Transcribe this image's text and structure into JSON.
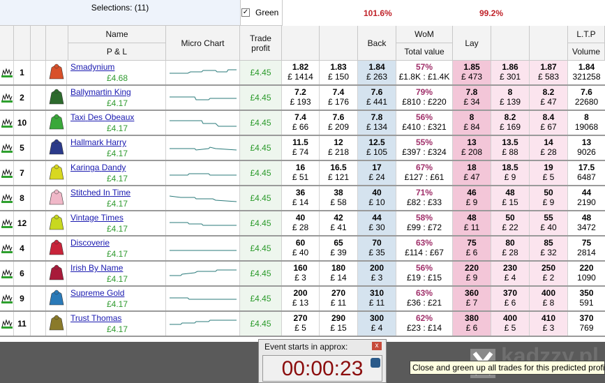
{
  "header": {
    "selections": "Selections: (11)",
    "green_label": "Green",
    "green_checked": "✓",
    "back_pct": "101.6%",
    "lay_pct": "99.2%",
    "name": "Name",
    "pl": "P & L",
    "micro_chart": "Micro Chart",
    "trade_profit": "Trade profit",
    "back": "Back",
    "wom": "WoM",
    "total_value": "Total value",
    "lay": "Lay",
    "ltp": "L.T.P",
    "volume": "Volume"
  },
  "colors": {
    "back_best": "#d5e3ef",
    "lay_best": "#f3c6d8",
    "lay_other": "#fbe4ee",
    "green": "#2e9a2e",
    "red": "#c0232a"
  },
  "runners": [
    {
      "num": "1",
      "name_a": "Smadynium",
      "name_b": "",
      "pl": "£4.68",
      "trade": "£4.45",
      "b1": "1.82",
      "b1s": "£ 1414",
      "b2": "1.83",
      "b2s": "£ 150",
      "b3": "1.84",
      "b3s": "£ 263",
      "wom": "57%",
      "womv": "£1.8K : £1.4K",
      "l1": "1.85",
      "l1s": "£ 473",
      "l2": "1.86",
      "l2s": "£ 301",
      "l3": "1.87",
      "l3s": "£ 583",
      "ltp": "1.84",
      "vol": "321258",
      "silk": "#d8502a"
    },
    {
      "num": "2",
      "name_a": "Ballymartin",
      "name_b": "King",
      "pl": "£4.17",
      "trade": "£4.45",
      "b1": "7.2",
      "b1s": "£ 193",
      "b2": "7.4",
      "b2s": "£ 176",
      "b3": "7.6",
      "b3s": "£ 441",
      "wom": "79%",
      "womv": "£810 : £220",
      "l1": "7.8",
      "l1s": "£ 34",
      "l2": "8",
      "l2s": "£ 139",
      "l3": "8.2",
      "l3s": "£ 47",
      "ltp": "7.6",
      "vol": "22680",
      "silk": "#2d6a2d"
    },
    {
      "num": "10",
      "name_a": "Taxi",
      "name_b": "Des",
      "name_c": "Obeaux",
      "pl": "£4.17",
      "trade": "£4.45",
      "b1": "7.4",
      "b1s": "£ 66",
      "b2": "7.6",
      "b2s": "£ 209",
      "b3": "7.8",
      "b3s": "£ 134",
      "wom": "56%",
      "womv": "£410 : £321",
      "l1": "8",
      "l1s": "£ 84",
      "l2": "8.2",
      "l2s": "£ 169",
      "l3": "8.4",
      "l3s": "£ 67",
      "ltp": "8",
      "vol": "19068",
      "silk": "#3aa83a"
    },
    {
      "num": "5",
      "name_a": "Hallmark",
      "name_b": "Harry",
      "pl": "£4.17",
      "trade": "£4.45",
      "b1": "11.5",
      "b1s": "£ 74",
      "b2": "12",
      "b2s": "£ 218",
      "b3": "12.5",
      "b3s": "£ 105",
      "wom": "55%",
      "womv": "£397 : £324",
      "l1": "13",
      "l1s": "£ 208",
      "l2": "13.5",
      "l2s": "£ 88",
      "l3": "14",
      "l3s": "£ 28",
      "ltp": "13",
      "vol": "9026",
      "silk": "#2b3a8a"
    },
    {
      "num": "7",
      "name_a": "Karinga",
      "name_b": "Dandy",
      "pl": "£4.17",
      "trade": "£4.45",
      "b1": "16",
      "b1s": "£ 51",
      "b2": "16.5",
      "b2s": "£ 121",
      "b3": "17",
      "b3s": "£ 24",
      "wom": "67%",
      "womv": "£127 : £61",
      "l1": "18",
      "l1s": "£ 47",
      "l2": "18.5",
      "l2s": "£ 9",
      "l3": "19",
      "l3s": "£ 5",
      "ltp": "17.5",
      "vol": "6487",
      "silk": "#d8d820"
    },
    {
      "num": "8",
      "name_a": "Stitched",
      "name_b": "In",
      "name_c": "Time",
      "pl": "£4.17",
      "trade": "£4.45",
      "b1": "36",
      "b1s": "£ 14",
      "b2": "38",
      "b2s": "£ 58",
      "b3": "40",
      "b3s": "£ 10",
      "wom": "71%",
      "womv": "£82 : £33",
      "l1": "46",
      "l1s": "£ 9",
      "l2": "48",
      "l2s": "£ 15",
      "l3": "50",
      "l3s": "£ 9",
      "ltp": "44",
      "vol": "2190",
      "silk": "#f0b8c8"
    },
    {
      "num": "12",
      "name_a": "Vintage",
      "name_b": "Times",
      "pl": "£4.17",
      "trade": "£4.45",
      "b1": "40",
      "b1s": "£ 28",
      "b2": "42",
      "b2s": "£ 41",
      "b3": "44",
      "b3s": "£ 30",
      "wom": "58%",
      "womv": "£99 : £72",
      "l1": "48",
      "l1s": "£ 11",
      "l2": "50",
      "l2s": "£ 22",
      "l3": "55",
      "l3s": "£ 40",
      "ltp": "48",
      "vol": "3472",
      "silk": "#c8d820"
    },
    {
      "num": "4",
      "name_a": "Discoverie",
      "name_b": "",
      "pl": "£4.17",
      "trade": "£4.45",
      "b1": "60",
      "b1s": "£ 40",
      "b2": "65",
      "b2s": "£ 39",
      "b3": "70",
      "b3s": "£ 35",
      "wom": "63%",
      "womv": "£114 : £67",
      "l1": "75",
      "l1s": "£ 6",
      "l2": "80",
      "l2s": "£ 28",
      "l3": "85",
      "l3s": "£ 32",
      "ltp": "75",
      "vol": "2814",
      "silk": "#c8243a"
    },
    {
      "num": "6",
      "name_a": "Irish",
      "name_b": "By",
      "name_c": "Name",
      "pl": "£4.17",
      "trade": "£4.45",
      "b1": "160",
      "b1s": "£ 3",
      "b2": "180",
      "b2s": "£ 14",
      "b3": "200",
      "b3s": "£ 3",
      "wom": "56%",
      "womv": "£19 : £15",
      "l1": "220",
      "l1s": "£ 9",
      "l2": "230",
      "l2s": "£ 4",
      "l3": "250",
      "l3s": "£ 2",
      "ltp": "220",
      "vol": "1090",
      "silk": "#a81a3a"
    },
    {
      "num": "9",
      "name_a": "Supreme",
      "name_b": "Gold",
      "pl": "£4.17",
      "trade": "£4.45",
      "b1": "200",
      "b1s": "£ 13",
      "b2": "270",
      "b2s": "£ 11",
      "b3": "310",
      "b3s": "£ 11",
      "wom": "63%",
      "womv": "£36 : £21",
      "l1": "360",
      "l1s": "£ 7",
      "l2": "370",
      "l2s": "£ 6",
      "l3": "400",
      "l3s": "£ 8",
      "ltp": "350",
      "vol": "591",
      "silk": "#2a7ab8"
    },
    {
      "num": "11",
      "name_a": "Trust",
      "name_b": "Thomas",
      "pl": "£4.17",
      "trade": "£4.45",
      "b1": "270",
      "b1s": "£ 5",
      "b2": "290",
      "b2s": "£ 15",
      "b3": "300",
      "b3s": "£ 4",
      "wom": "62%",
      "womv": "£23 : £14",
      "l1": "380",
      "l1s": "£ 6",
      "l2": "400",
      "l2s": "£ 5",
      "l3": "410",
      "l3s": "£ 3",
      "ltp": "370",
      "vol": "769",
      "silk": "#8a7a2a"
    }
  ],
  "event": {
    "title": "Event starts in approx:",
    "close": "x",
    "time": "00:00:23"
  },
  "tooltip": "Close and green up all trades for this predicted profit",
  "watermark": "kadzzy.pl"
}
